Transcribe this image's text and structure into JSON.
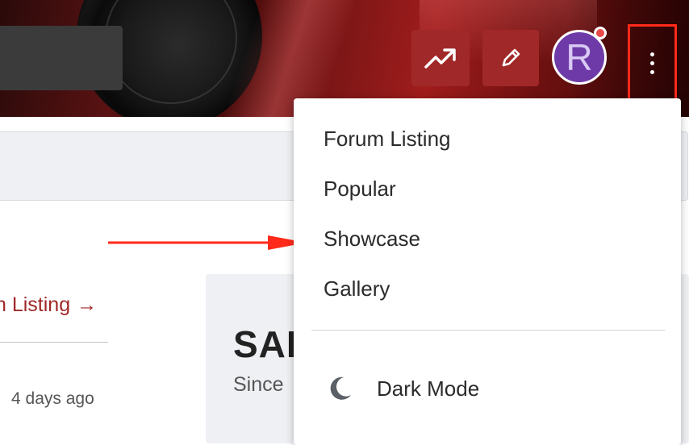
{
  "header": {
    "trending_icon": "trending-up-icon",
    "post_icon": "pencil-icon",
    "avatar_letter": "R",
    "more_icon": "vertical-dots-icon",
    "accent_color": "#a12828",
    "highlight_color": "#ff2a1a"
  },
  "page": {
    "forum_link_label": "n Listing",
    "forum_link_arrow": "→",
    "time_ago": "4 days ago",
    "card_title": "SAI",
    "card_subtitle": "Since"
  },
  "menu": {
    "items": [
      {
        "label": "Forum Listing"
      },
      {
        "label": "Popular"
      },
      {
        "label": "Showcase"
      },
      {
        "label": "Gallery"
      }
    ],
    "dark_mode": {
      "label": "Dark Mode",
      "icon": "moon-icon"
    }
  }
}
